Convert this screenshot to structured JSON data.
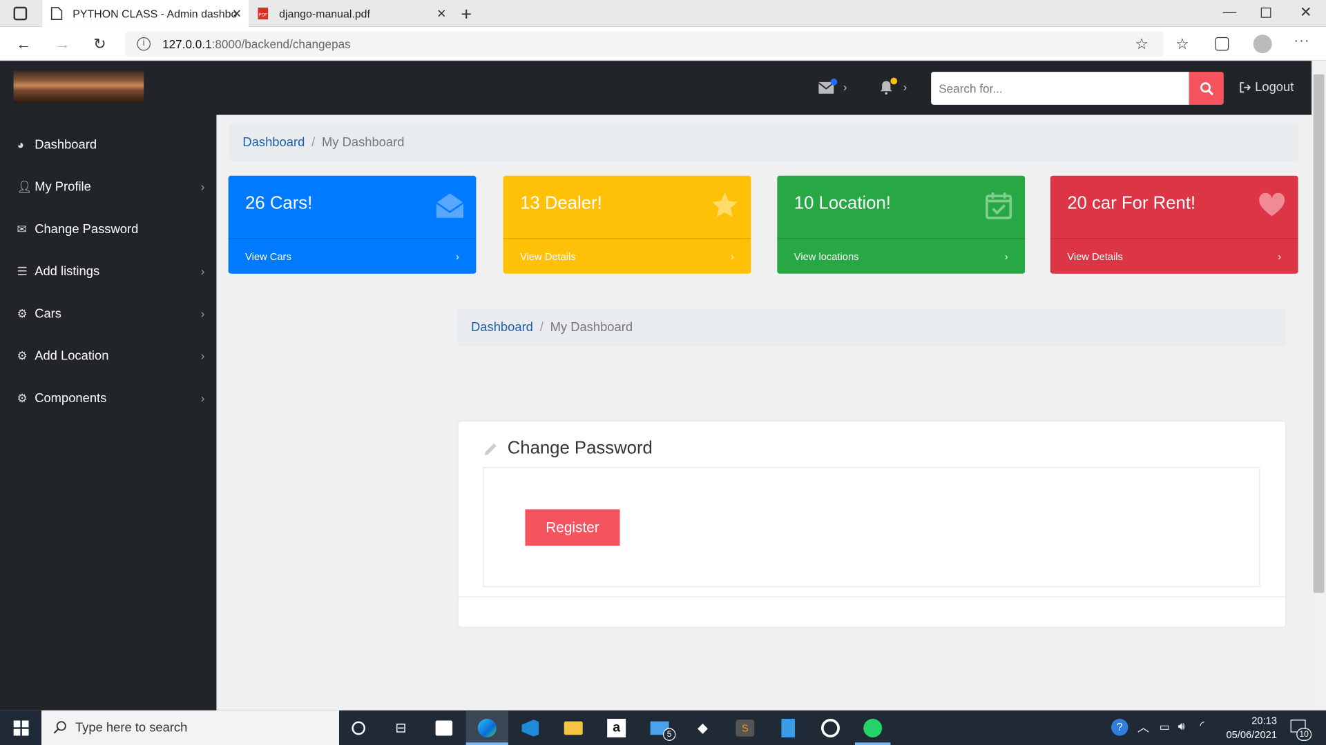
{
  "browser": {
    "tabs": [
      {
        "title": "PYTHON CLASS - Admin dashbo"
      },
      {
        "title": "django-manual.pdf"
      }
    ],
    "url_host": "127.0.0.1",
    "url_path": ":8000/backend/changepas"
  },
  "topnav": {
    "search_placeholder": "Search for...",
    "logout_label": "Logout"
  },
  "sidebar": {
    "items": [
      {
        "label": "Dashboard",
        "icon": "dashboard-icon",
        "has_chevron": false
      },
      {
        "label": "My Profile",
        "icon": "user-icon",
        "has_chevron": true
      },
      {
        "label": "Change Password",
        "icon": "envelope-open-icon",
        "has_chevron": false
      },
      {
        "label": "Add listings",
        "icon": "list-icon",
        "has_chevron": true
      },
      {
        "label": "Cars",
        "icon": "gear-icon",
        "has_chevron": true
      },
      {
        "label": "Add Location",
        "icon": "gear-icon",
        "has_chevron": true
      },
      {
        "label": "Components",
        "icon": "gear-icon",
        "has_chevron": true
      }
    ]
  },
  "breadcrumb": {
    "link": "Dashboard",
    "separator": "/",
    "current": "My Dashboard"
  },
  "cards": [
    {
      "title": "26 Cars!",
      "link": "View Cars",
      "color": "#007bff",
      "icon": "envelope-open-icon"
    },
    {
      "title": "13 Dealer!",
      "link": "View Details",
      "color": "#ffc107",
      "icon": "star-icon"
    },
    {
      "title": "10 Location!",
      "link": "View locations",
      "color": "#28a745",
      "icon": "calendar-check-icon"
    },
    {
      "title": "20 car For Rent!",
      "link": "View Details",
      "color": "#dc3545",
      "icon": "heart-icon"
    }
  ],
  "change_password": {
    "title": "Change Password",
    "register_label": "Register"
  },
  "taskbar": {
    "search_placeholder": "Type here to search",
    "time": "20:13",
    "date": "05/06/2021",
    "mail_badge": "5",
    "notif_badge": "10"
  }
}
